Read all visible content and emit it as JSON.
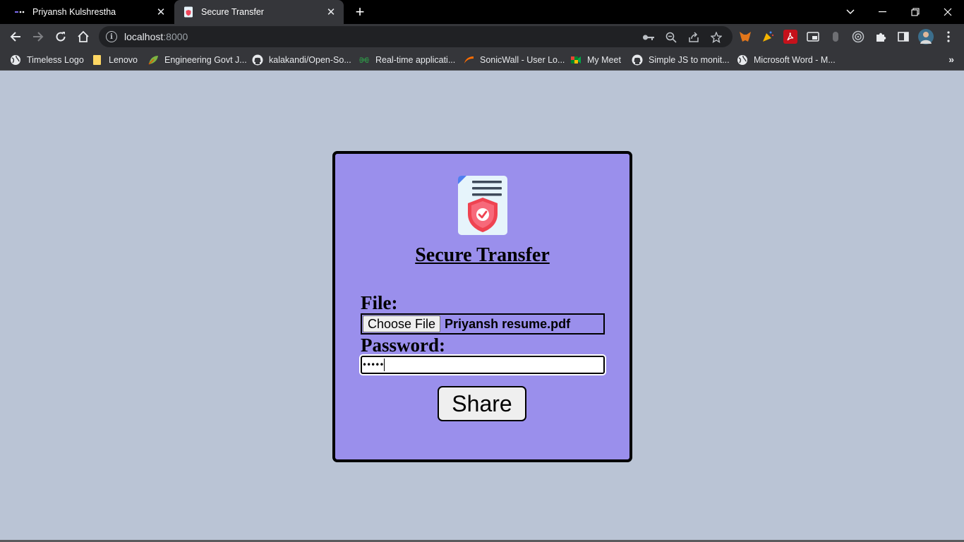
{
  "browser": {
    "tabs": [
      {
        "title": "Priyansh Kulshrestha",
        "active": false
      },
      {
        "title": "Secure Transfer",
        "active": true
      }
    ],
    "new_tab": "+",
    "address": {
      "host": "localhost",
      "port": ":8000"
    },
    "bookmarks": [
      {
        "label": "Timeless Logo",
        "icon": "globe-icon"
      },
      {
        "label": "Lenovo",
        "icon": "folder-icon"
      },
      {
        "label": "Engineering Govt J...",
        "icon": "leaf-icon"
      },
      {
        "label": "kalakandi/Open-So...",
        "icon": "github-icon"
      },
      {
        "label": "Real-time applicati...",
        "icon": "gfg-icon"
      },
      {
        "label": "SonicWall - User Lo...",
        "icon": "sonicwall-icon"
      },
      {
        "label": "My Meet",
        "icon": "meet-icon"
      },
      {
        "label": "Simple JS to monit...",
        "icon": "github-icon"
      },
      {
        "label": "Microsoft Word - M...",
        "icon": "globe-icon"
      }
    ],
    "bookmarks_more": "»"
  },
  "page": {
    "title": "Secure Transfer",
    "file_label": "File:",
    "choose_file_label": "Choose File",
    "file_name": "Priyansh resume.pdf",
    "password_label": "Password:",
    "password_mask": "•••••",
    "share_label": "Share"
  },
  "colors": {
    "page_background": "#bac4d5",
    "card_background": "#9a8fec",
    "border": "#000000"
  }
}
